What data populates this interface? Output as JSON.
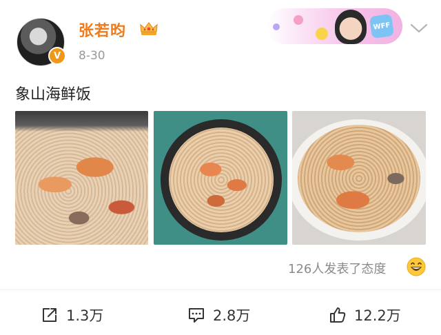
{
  "header": {
    "username": "张若昀",
    "verified_badge": "V",
    "date": "8-30",
    "promo_badge": "WFF"
  },
  "post": {
    "text": "象山海鲜饭"
  },
  "footer": {
    "reactions_text": "126人发表了态度"
  },
  "actions": {
    "share_count": "1.3万",
    "comment_count": "2.8万",
    "like_count": "12.2万"
  },
  "icons": {
    "crown": "crown-icon",
    "more": "chevron-down-icon",
    "share": "share-icon",
    "comment": "comment-icon",
    "like": "thumbs-up-icon",
    "reaction": "laughing-emoji-icon"
  },
  "colors": {
    "username": "#f07a1a",
    "badge": "#f0971a",
    "muted": "#9a9a9a"
  }
}
